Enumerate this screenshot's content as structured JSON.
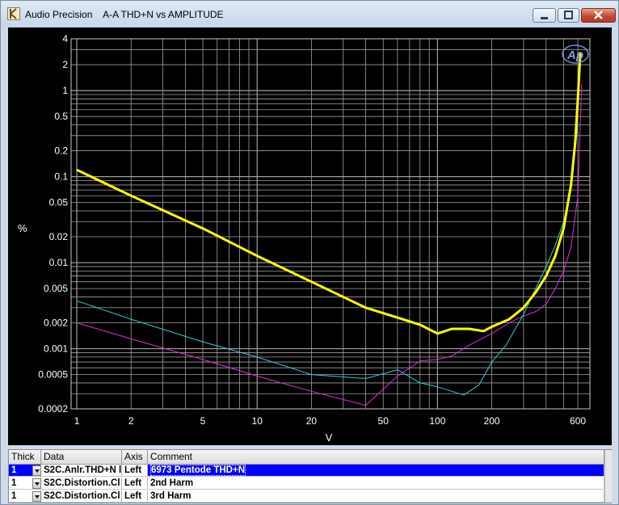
{
  "window": {
    "app_name": "Audio Precision",
    "title": "A-A THD+N vs AMPLITUDE"
  },
  "colors": {
    "plot_bg": "#000000",
    "grid": "#a0a0a0",
    "axis_text": "#ffffff",
    "selection": "#0000ff"
  },
  "chart_data": {
    "type": "line",
    "xlabel": "V",
    "ylabel": "%",
    "x_scale": "log",
    "y_scale": "log",
    "xlim": [
      0.93,
      700
    ],
    "ylim": [
      0.0002,
      4
    ],
    "x_ticks": [
      1,
      2,
      5,
      10,
      20,
      50,
      100,
      200,
      600
    ],
    "x_tick_labels": [
      "1",
      "2",
      "5",
      "10",
      "20",
      "50",
      "100",
      "200",
      "600"
    ],
    "y_ticks": [
      0.0002,
      0.0005,
      0.001,
      0.002,
      0.005,
      0.01,
      0.02,
      0.05,
      0.1,
      0.2,
      0.5,
      1,
      2,
      4
    ],
    "y_tick_labels": [
      "0.0002",
      "0.0005",
      "0.001",
      "0.002",
      "0.005",
      "0.01",
      "0.02",
      "0.05",
      "0.1",
      "0.2",
      "0.5",
      "1",
      "2",
      "4"
    ],
    "grid": true,
    "logo": "Ap",
    "series": [
      {
        "name": "6973 Pentode THD+N",
        "color": "#ffff00",
        "width": 3,
        "x": [
          1,
          2,
          5,
          10,
          20,
          40,
          60,
          80,
          100,
          120,
          150,
          180,
          200,
          250,
          300,
          350,
          400,
          450,
          500,
          550,
          580,
          600,
          620
        ],
        "y": [
          0.12,
          0.06,
          0.025,
          0.012,
          0.006,
          0.003,
          0.0023,
          0.0019,
          0.0015,
          0.0017,
          0.0017,
          0.0016,
          0.0018,
          0.0022,
          0.003,
          0.0045,
          0.007,
          0.012,
          0.025,
          0.08,
          0.25,
          0.8,
          2.8
        ]
      },
      {
        "name": "2nd Harm",
        "color": "#27d0d0",
        "width": 1,
        "x": [
          1,
          2,
          5,
          10,
          20,
          40,
          60,
          80,
          100,
          140,
          170,
          200,
          240,
          300,
          350,
          400,
          450,
          500,
          550,
          600
        ],
        "y": [
          0.0036,
          0.0022,
          0.0012,
          0.0008,
          0.0005,
          0.00045,
          0.00057,
          0.0004,
          0.00036,
          0.00029,
          0.00038,
          0.0007,
          0.0011,
          0.0025,
          0.005,
          0.009,
          0.016,
          0.03,
          0.07,
          0.4
        ]
      },
      {
        "name": "3rd Harm",
        "color": "#dd30dd",
        "width": 1,
        "x": [
          1,
          2,
          5,
          10,
          20,
          40,
          60,
          80,
          100,
          120,
          150,
          200,
          250,
          300,
          350,
          400,
          450,
          500,
          550,
          600,
          630
        ],
        "y": [
          0.002,
          0.0013,
          0.00075,
          0.00048,
          0.00032,
          0.00022,
          0.00048,
          0.00072,
          0.00075,
          0.00082,
          0.0011,
          0.0015,
          0.002,
          0.0024,
          0.0027,
          0.0033,
          0.005,
          0.008,
          0.015,
          0.06,
          1.2
        ]
      }
    ]
  },
  "table": {
    "headers": [
      "Thick",
      "Data",
      "Axis",
      "Comment"
    ],
    "rows": [
      {
        "thick": "1",
        "data": "S2C.Anlr.THD+N l",
        "axis": "Left",
        "comment": "6973 Pentode THD+N"
      },
      {
        "thick": "1",
        "data": "S2C.Distortion.Cl",
        "axis": "Left",
        "comment": "2nd Harm"
      },
      {
        "thick": "1",
        "data": "S2C.Distortion.Cl",
        "axis": "Left",
        "comment": "3rd Harm"
      }
    ]
  }
}
